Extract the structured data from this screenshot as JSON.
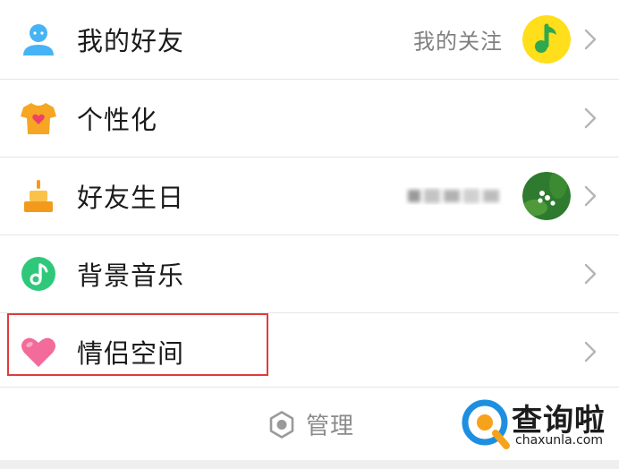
{
  "menu": {
    "items": [
      {
        "label": "我的好友",
        "right_text": "我的关注",
        "icon": "friend-person-icon",
        "color": "#46b3f5"
      },
      {
        "label": "个性化",
        "icon": "tshirt-heart-icon",
        "color": "#f6a623"
      },
      {
        "label": "好友生日",
        "icon": "birthday-cake-icon",
        "color": "#f39a1c"
      },
      {
        "label": "背景音乐",
        "icon": "music-note-icon",
        "color": "#2fc87a"
      },
      {
        "label": "情侣空间",
        "icon": "heart-icon",
        "color": "#f26b9a"
      }
    ]
  },
  "footer": {
    "manage_label": "管理",
    "manage_icon": "hexagon-settings-icon"
  },
  "watermark": {
    "text": "查询啦",
    "url": "chaxunla.com"
  },
  "colors": {
    "highlight": "#e23a3a",
    "divider": "#e6e6e6",
    "secondary_text": "#7f7f7f"
  }
}
